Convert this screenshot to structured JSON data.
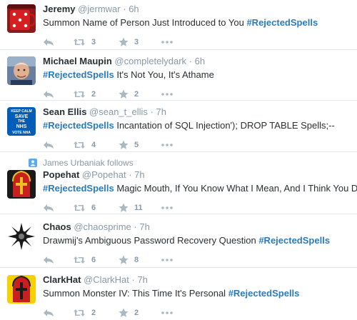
{
  "tweets": [
    {
      "name": "Jeremy",
      "handle": "@jermwar",
      "separator": "·",
      "time": "6h",
      "text_prefix": "Summon Name of Person Just Introduced to You ",
      "hashtag": "#RejectedSpells",
      "text_suffix": "",
      "retweets": "3",
      "favorites": "3",
      "avatar": "red-dice-mug"
    },
    {
      "name": "Michael Maupin",
      "handle": "@completelydark",
      "separator": "·",
      "time": "6h",
      "text_prefix": "",
      "hashtag": "#RejectedSpells",
      "text_suffix": " It's Not You, It's Athame",
      "retweets": "2",
      "favorites": "2",
      "avatar": "man-photo"
    },
    {
      "name": "Sean Ellis",
      "handle": "@sean_t_ellis",
      "separator": "·",
      "time": "7h",
      "text_prefix": "",
      "hashtag": "#RejectedSpells",
      "text_suffix": " Incantation of SQL Injection'); DROP TABLE Spells;--",
      "retweets": "4",
      "favorites": "5",
      "avatar": "keep-calm-save-nhs"
    },
    {
      "context": "James Urbaniak follows",
      "name": "Popehat",
      "handle": "@Popehat",
      "separator": "·",
      "time": "7h",
      "text_prefix": "",
      "hashtag": "#RejectedSpells",
      "text_suffix": " Magic Mouth, If You Know What I Mean, And I Think You Do",
      "retweets": "6",
      "favorites": "11",
      "avatar": "popehat-mitre"
    },
    {
      "name": "Chaos",
      "handle": "@chaosprime",
      "separator": "·",
      "time": "7h",
      "text_prefix": "Drawmij's Ambiguous Password Recovery Question ",
      "hashtag": "#RejectedSpells",
      "text_suffix": "",
      "retweets": "6",
      "favorites": "8",
      "avatar": "chaos-star"
    },
    {
      "name": "ClarkHat",
      "handle": "@ClarkHat",
      "separator": "·",
      "time": "7h",
      "text_prefix": "Summon Monster IV: This Time It's Personal ",
      "hashtag": "#RejectedSpells",
      "text_suffix": "",
      "retweets": "2",
      "favorites": "2",
      "avatar": "clarkhat-mitre"
    }
  ],
  "avatar_texts": {
    "keep_calm": [
      "KEEP CALM",
      "SAVE",
      "THE",
      "NHS",
      "VOTE NHA"
    ]
  },
  "colors": {
    "hashtag": "#2b7bb9",
    "muted": "#8899a6",
    "icon": "#aab8c2",
    "divider": "#e1e8ed"
  }
}
